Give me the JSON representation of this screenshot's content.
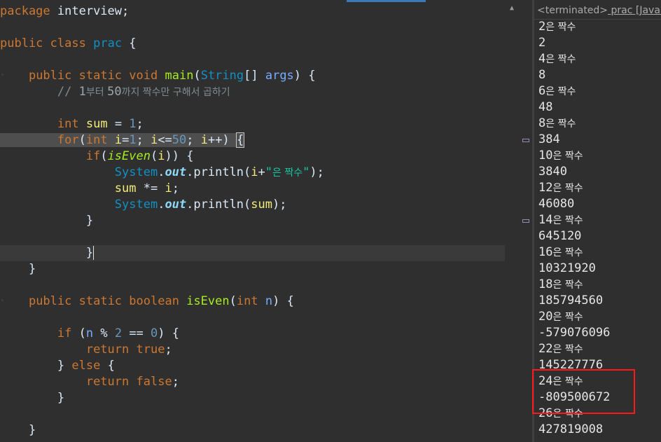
{
  "editor": {
    "l1": {
      "kw": "package",
      "rest": " interview;"
    },
    "l3": {
      "kw1": "public",
      "kw2": "class",
      "cls": "prac",
      "rest": " {"
    },
    "l5": {
      "kw1": "public",
      "kw2": "static",
      "kw3": "void",
      "fn": "main",
      "p1": "(",
      "cls": "String",
      "p2": "[] ",
      "param": "args",
      "p3": ") {"
    },
    "l6": {
      "cm1": "// ",
      "n1": "1",
      "k1": "부터 ",
      "n2": "50",
      "k2": "까지 짝수만 구해서 곱하기"
    },
    "l8": {
      "kw": "int",
      "var": "sum",
      "eq": " = ",
      "num": "1",
      "end": ";"
    },
    "l9": {
      "kw": "for",
      "p1": "(",
      "kw2": "int",
      "var1": "i",
      "eq": "=",
      "n1": "1",
      "sc1": "; ",
      "var2": "i",
      "op": "<=",
      "n2": "50",
      "sc2": "; ",
      "var3": "i",
      "inc": "++) ",
      "br": "{"
    },
    "l10": {
      "kw": "if",
      "p1": "(",
      "fn": "isEven",
      "p2": "(",
      "var": "i",
      "p3": ")) {"
    },
    "l11": {
      "cls": "System",
      "dot": ".",
      "fld": "out",
      "call": ".println(",
      "var": "i",
      "plus": "+",
      "str1": "\"",
      "kor": "은 짝수",
      "str2": "\"",
      "end": ");"
    },
    "l12": {
      "var1": "sum",
      "op": " *= ",
      "var2": "i",
      "end": ";"
    },
    "l13": {
      "cls": "System",
      "dot": ".",
      "fld": "out",
      "call": ".println(",
      "var": "sum",
      "end": ");"
    },
    "l14": {
      "br": "}"
    },
    "l16": {
      "br": "}"
    },
    "l17": {
      "br": "}"
    },
    "l19": {
      "kw1": "public",
      "kw2": "static",
      "kw3": "boolean",
      "fn": "isEven",
      "p1": "(",
      "kw4": "int",
      "param": "n",
      "p2": ") {"
    },
    "l21": {
      "kw": "if",
      "p1": " (",
      "param": "n",
      "op": " % ",
      "n1": "2",
      "eq": " == ",
      "n2": "0",
      "p2": ") {"
    },
    "l22": {
      "kw": "return",
      "kw2": "true",
      "end": ";"
    },
    "l23": {
      "b1": "} ",
      "kw": "else",
      "b2": " {"
    },
    "l24": {
      "kw": "return",
      "kw2": "false",
      "end": ";"
    },
    "l25": {
      "br": "}"
    },
    "l27": {
      "br": "}"
    }
  },
  "console": {
    "header_prefix": "<terminated>",
    "header_rest": " prac [Java A",
    "output": [
      {
        "num": "2",
        "kor": "은 짝수"
      },
      {
        "num": "2",
        "kor": ""
      },
      {
        "num": "4",
        "kor": "은 짝수"
      },
      {
        "num": "8",
        "kor": ""
      },
      {
        "num": "6",
        "kor": "은 짝수"
      },
      {
        "num": "48",
        "kor": ""
      },
      {
        "num": "8",
        "kor": "은 짝수"
      },
      {
        "num": "384",
        "kor": ""
      },
      {
        "num": "10",
        "kor": "은 짝수"
      },
      {
        "num": "3840",
        "kor": ""
      },
      {
        "num": "12",
        "kor": "은 짝수"
      },
      {
        "num": "46080",
        "kor": ""
      },
      {
        "num": "14",
        "kor": "은 짝수"
      },
      {
        "num": "645120",
        "kor": ""
      },
      {
        "num": "16",
        "kor": "은 짝수"
      },
      {
        "num": "10321920",
        "kor": ""
      },
      {
        "num": "18",
        "kor": "은 짝수"
      },
      {
        "num": "185794560",
        "kor": ""
      },
      {
        "num": "20",
        "kor": "은 짝수"
      },
      {
        "num": "-579076096",
        "kor": ""
      },
      {
        "num": "22",
        "kor": "은 짝수"
      },
      {
        "num": "145227776",
        "kor": ""
      },
      {
        "num": "24",
        "kor": "은 짝수"
      },
      {
        "num": "-809500672",
        "kor": ""
      },
      {
        "num": "26",
        "kor": "은 짝수"
      },
      {
        "num": "427819008",
        "kor": ""
      }
    ]
  },
  "colors": {
    "highlight_box": "#ff1a1a",
    "editor_bg": "#2f2f2f"
  }
}
